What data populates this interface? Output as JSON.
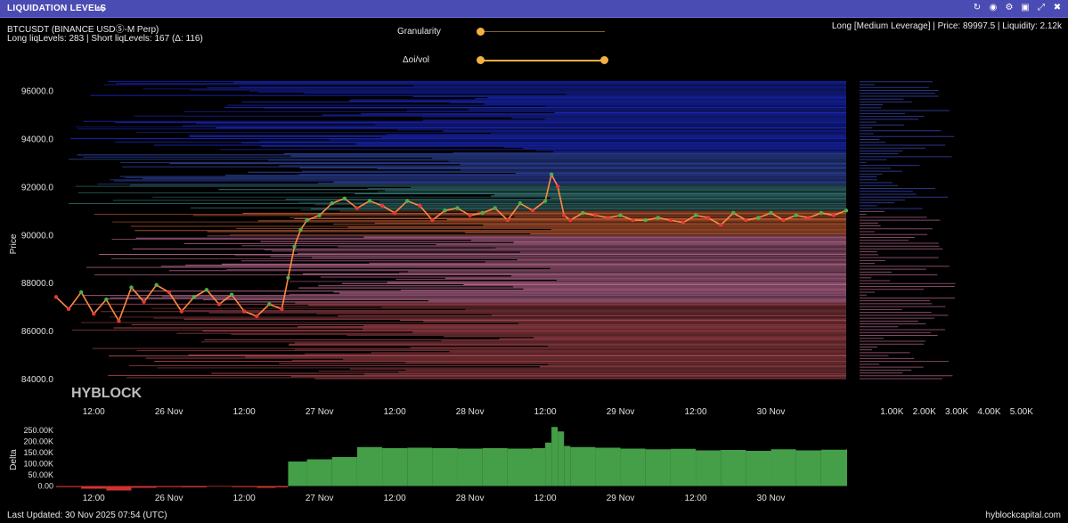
{
  "window": {
    "title": "LIQUIDATION LEVELS",
    "icons": [
      "settings-sliders-icon",
      "refresh-icon",
      "camera-icon",
      "gear-icon",
      "save-icon",
      "expand-icon",
      "close-icon"
    ]
  },
  "header": {
    "symbol": "BTCUSDT (BINANCE USDⓈ-M Perp)",
    "levels": "Long liqLevels: 283 | Short liqLevels: 167 (Δ: 116)",
    "right_info": "Long [Medium Leverage] | Price: 89997.5 | Liquidity: 2.12k"
  },
  "controls": {
    "granularity_label": "Granularity",
    "granularity_value": 0.0,
    "oivol_label": "Δoi/vol",
    "oivol_range": [
      0.0,
      1.0
    ]
  },
  "watermark": "HYBLOCK",
  "footer": {
    "last_updated": "Last Updated: 30 Nov 2025 07:54 (UTC)",
    "site": "hyblockcapital.com"
  },
  "colors": {
    "up": "#4caf50",
    "down": "#e53935",
    "accent": "#f5b043",
    "titlebar": "#4b4bb4"
  },
  "chart_data": [
    {
      "type": "line",
      "title": "",
      "ylabel": "Price",
      "ylim": [
        83000,
        96500
      ],
      "yticks": [
        "96000.0",
        "94000.0",
        "92000.0",
        "90000.0",
        "88000.0",
        "86000.0",
        "84000.0"
      ],
      "yticks_values": [
        96000,
        94000,
        92000,
        90000,
        88000,
        86000,
        84000
      ],
      "xticks": [
        "12:00",
        "26 Nov",
        "12:00",
        "27 Nov",
        "12:00",
        "28 Nov",
        "12:00",
        "29 Nov",
        "12:00",
        "30 Nov"
      ],
      "xtick_hours": [
        12,
        24,
        36,
        48,
        60,
        72,
        84,
        96,
        108,
        120
      ],
      "x_hours_range": [
        6,
        132
      ],
      "price_series": {
        "name": "BTCUSDT",
        "x_hours": [
          6,
          8,
          10,
          12,
          14,
          16,
          18,
          20,
          22,
          24,
          26,
          28,
          30,
          32,
          34,
          36,
          38,
          40,
          42,
          43,
          44,
          45,
          46,
          48,
          50,
          52,
          54,
          56,
          58,
          60,
          62,
          64,
          66,
          68,
          70,
          72,
          74,
          76,
          78,
          80,
          82,
          84,
          85,
          86,
          87,
          88,
          90,
          92,
          94,
          96,
          98,
          100,
          102,
          104,
          106,
          108,
          110,
          112,
          114,
          116,
          118,
          120,
          122,
          124,
          126,
          128,
          130,
          132
        ],
        "values": [
          87400,
          86900,
          87600,
          86700,
          87300,
          86400,
          87800,
          87200,
          87900,
          87600,
          86800,
          87400,
          87700,
          87100,
          87500,
          86800,
          86600,
          87100,
          86900,
          88200,
          89500,
          90200,
          90600,
          90800,
          91300,
          91500,
          91100,
          91400,
          91200,
          90900,
          91400,
          91200,
          90600,
          91000,
          91100,
          90800,
          90900,
          91100,
          90600,
          91300,
          91000,
          91400,
          92500,
          92000,
          90800,
          90600,
          90900,
          90800,
          90700,
          90800,
          90600,
          90600,
          90700,
          90600,
          90500,
          90800,
          90700,
          90400,
          90900,
          90600,
          90700,
          90900,
          90600,
          90800,
          90700,
          90900,
          90800,
          91000
        ]
      }
    },
    {
      "type": "bar",
      "title": "",
      "xlabel": "",
      "ylabel": "Delta",
      "ylim": [
        -10000,
        270000
      ],
      "yticks": [
        "250.00K",
        "200.00K",
        "150.00K",
        "100.00K",
        "50.00K",
        "0.00"
      ],
      "yticks_values": [
        250000,
        200000,
        150000,
        100000,
        50000,
        0
      ],
      "xticks": [
        "12:00",
        "26 Nov",
        "12:00",
        "27 Nov",
        "12:00",
        "28 Nov",
        "12:00",
        "29 Nov",
        "12:00",
        "30 Nov"
      ],
      "x_hours": [
        6,
        10,
        14,
        18,
        22,
        26,
        30,
        34,
        38,
        41,
        43,
        46,
        50,
        54,
        58,
        62,
        66,
        70,
        74,
        78,
        82,
        84,
        85,
        86,
        87,
        88,
        92,
        96,
        100,
        104,
        108,
        112,
        116,
        120,
        124,
        128,
        132
      ],
      "values": [
        -5000,
        -12000,
        -20000,
        -8000,
        -5000,
        -6000,
        -3000,
        -5000,
        -8000,
        -6000,
        110000,
        120000,
        130000,
        175000,
        170000,
        172000,
        170000,
        168000,
        170000,
        168000,
        170000,
        195000,
        265000,
        245000,
        180000,
        175000,
        172000,
        168000,
        165000,
        167000,
        160000,
        162000,
        158000,
        165000,
        160000,
        163000,
        165000
      ]
    },
    {
      "type": "bar",
      "title": "",
      "xticks": [
        "1.00K",
        "2.00K",
        "3.00K",
        "4.00K",
        "5.00K"
      ],
      "xticks_values": [
        1000,
        2000,
        3000,
        4000,
        5000
      ],
      "xlim": [
        0,
        5500
      ]
    }
  ]
}
